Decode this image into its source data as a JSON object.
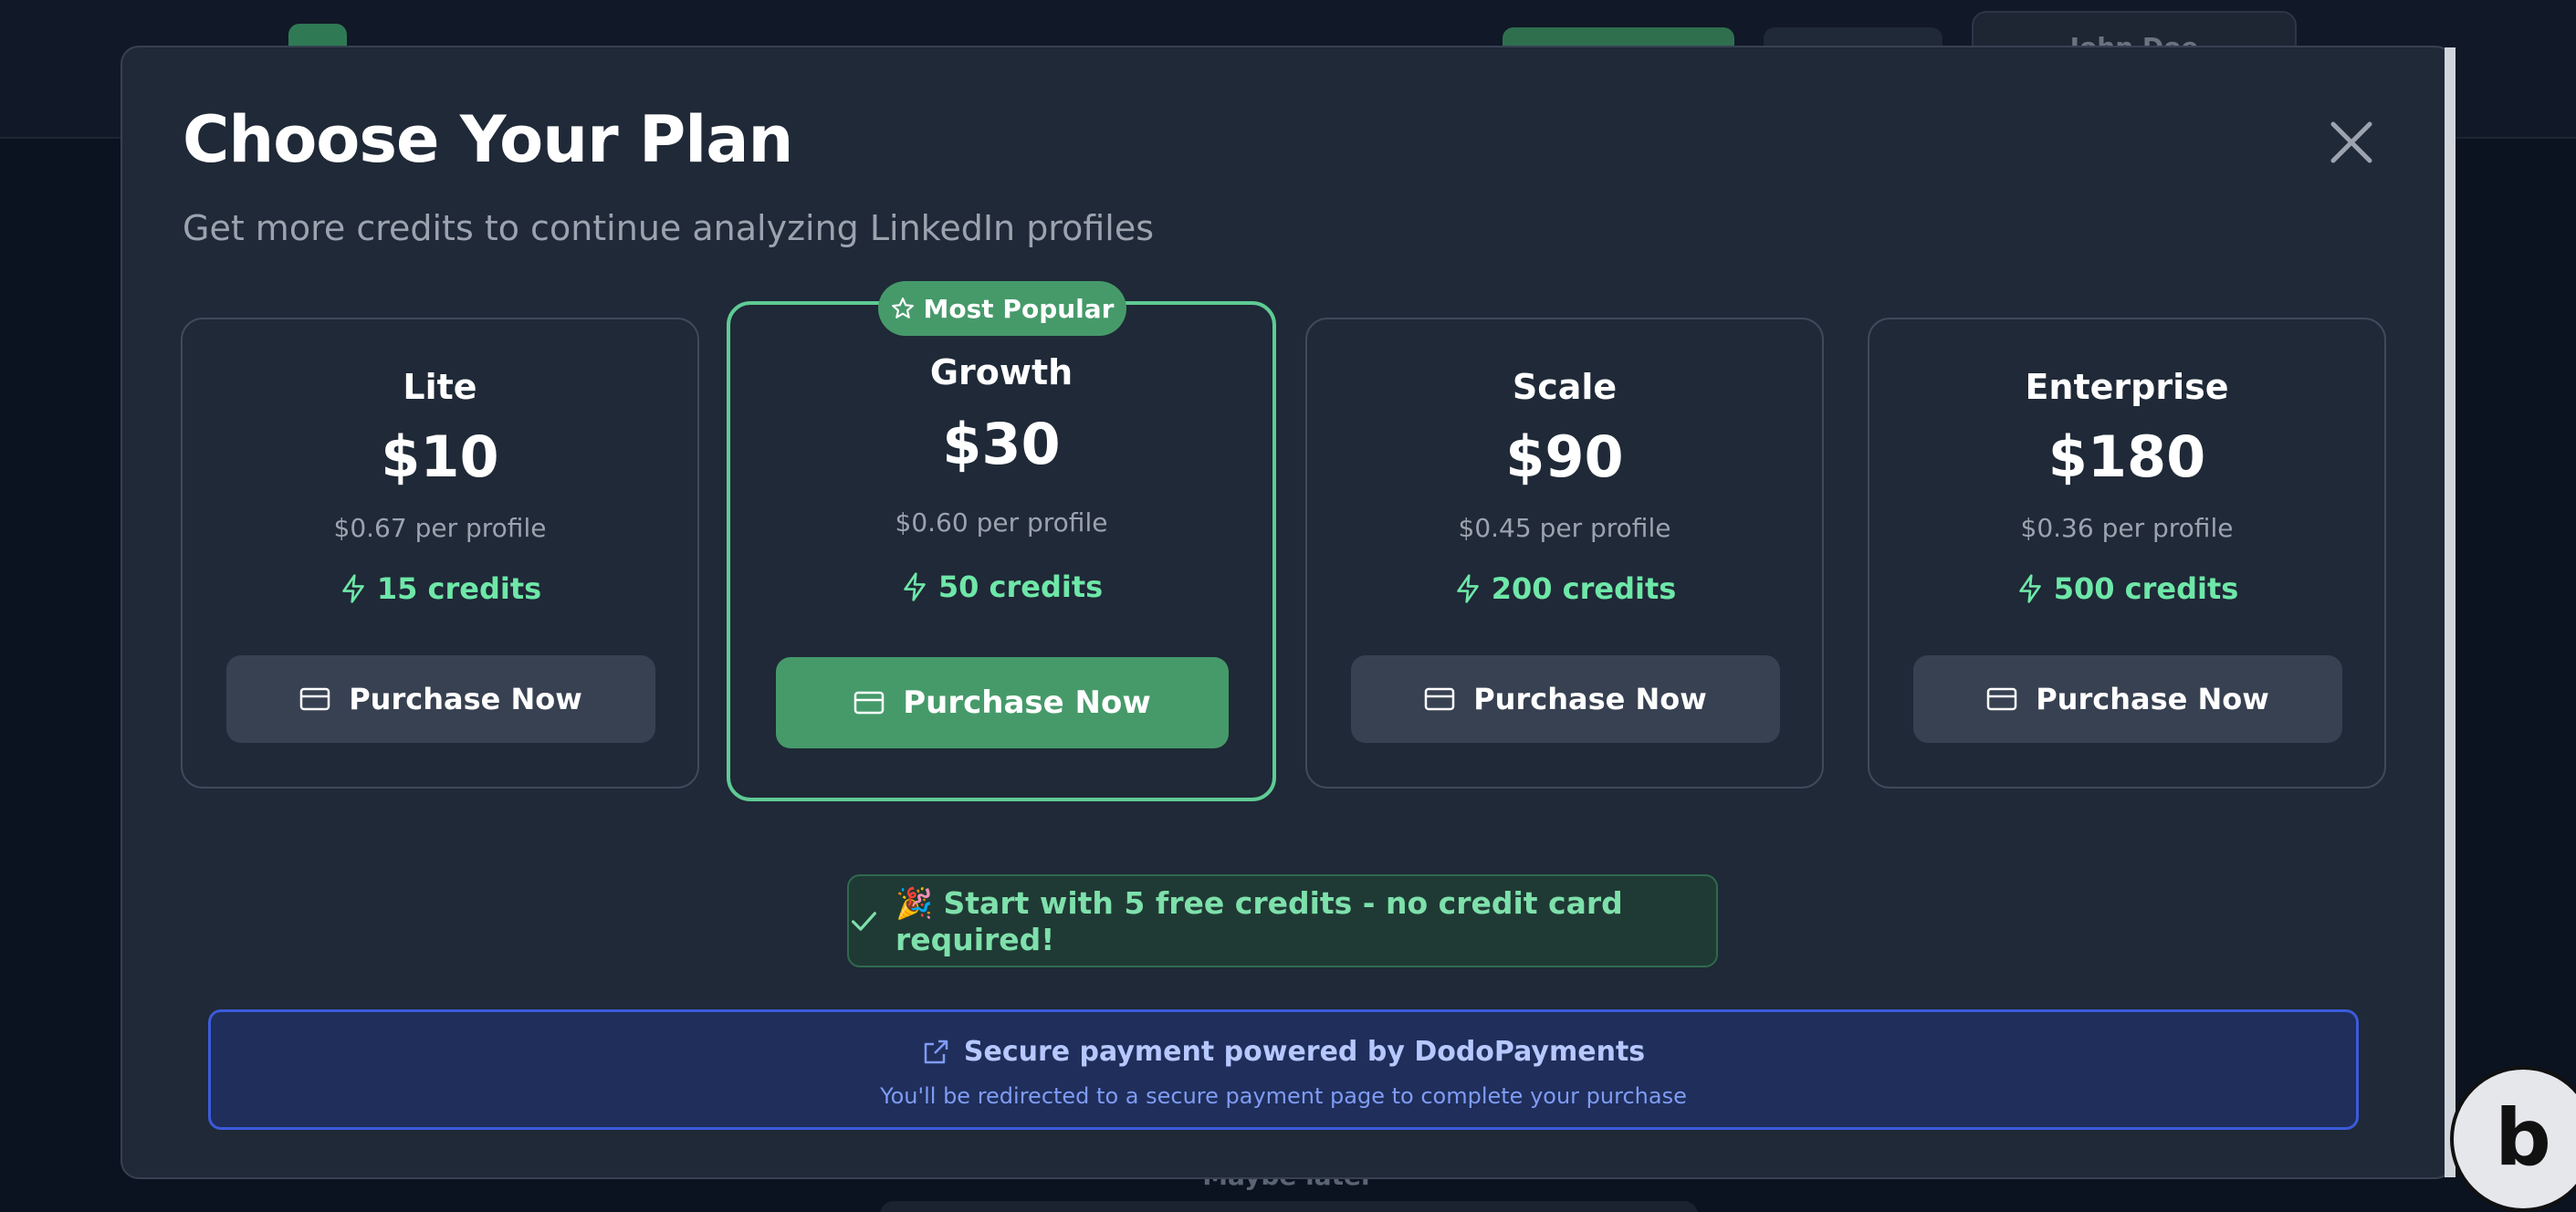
{
  "background": {
    "user_name": "John Doe",
    "maybe_later": "Maybe later"
  },
  "modal": {
    "title": "Choose Your Plan",
    "subtitle": "Get more credits to continue analyzing LinkedIn profiles",
    "close_icon": "close-icon"
  },
  "plans": [
    {
      "name": "Lite",
      "price": "$10",
      "per_profile": "$0.67 per profile",
      "credits": "15 credits",
      "button": "Purchase Now",
      "popular": false
    },
    {
      "name": "Growth",
      "price": "$30",
      "per_profile": "$0.60 per profile",
      "credits": "50 credits",
      "button": "Purchase Now",
      "popular": true
    },
    {
      "name": "Scale",
      "price": "$90",
      "per_profile": "$0.45 per profile",
      "credits": "200 credits",
      "button": "Purchase Now",
      "popular": false
    },
    {
      "name": "Enterprise",
      "price": "$180",
      "per_profile": "$0.36 per profile",
      "credits": "500 credits",
      "button": "Purchase Now",
      "popular": false
    }
  ],
  "popular_badge": "Most Popular",
  "free_banner": "🎉 Start with 5 free credits - no credit card required!",
  "secure": {
    "title": "Secure payment powered by DodoPayments",
    "subtitle": "You'll be redirected to a secure payment page to complete your purchase"
  },
  "bolt_badge": "b",
  "colors": {
    "accent_green": "#469a6a",
    "credits_green": "#6ee7a8",
    "popular_border": "#5fcb94",
    "secure_blue": "#3b5bdb"
  }
}
